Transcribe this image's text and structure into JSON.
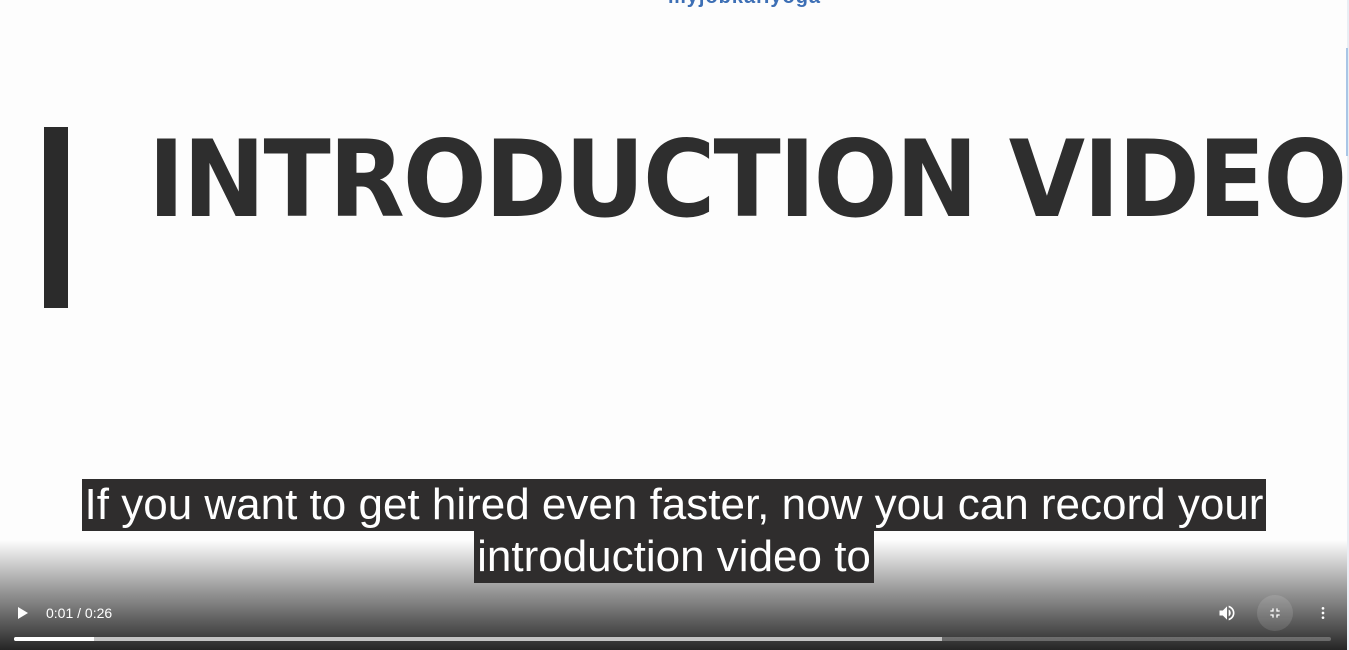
{
  "video": {
    "logo_text": "myjobkar.yoga",
    "headline": "INTRODUCTION VIDEO",
    "caption_lines": [
      "If you want to get hired even faster, now you can record your",
      "introduction video to"
    ]
  },
  "controls": {
    "play_icon": "play-icon",
    "time_display": "0:01 / 0:26",
    "volume_icon": "volume-icon",
    "exit_fullscreen_icon": "exit-fullscreen-icon",
    "more_icon": "more-options-icon",
    "progress": {
      "played_fraction": 0.061,
      "buffered_fraction": 0.705
    }
  },
  "colors": {
    "headline": "#2e2e2e",
    "caption_bg": "#2f2d2d",
    "caption_text": "#ffffff",
    "logo": "#3d6fb5"
  }
}
